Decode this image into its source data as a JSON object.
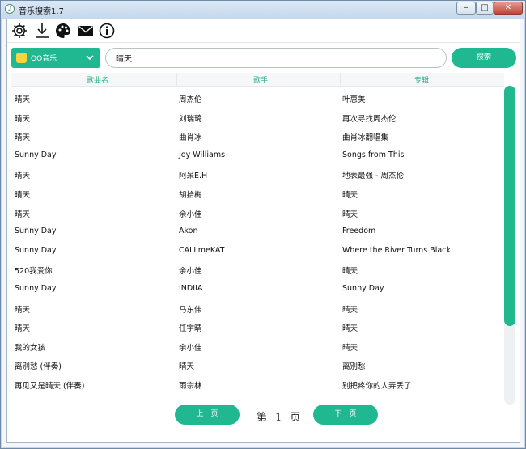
{
  "window": {
    "title": "音乐搜索1.7",
    "controls": {
      "minimize": "–",
      "maximize": "□",
      "close": "✕"
    }
  },
  "toolbar": {
    "icons": [
      "gear-icon",
      "download-icon",
      "palette-icon",
      "mail-icon",
      "info-icon"
    ]
  },
  "search": {
    "source": "QQ音乐",
    "query": "晴天",
    "button": "搜索"
  },
  "table": {
    "columns": [
      "歌曲名",
      "歌手",
      "专辑"
    ],
    "rows": [
      [
        "晴天",
        "周杰伦",
        "叶惠美"
      ],
      [
        "晴天",
        "刘瑞琦",
        "再次寻找周杰伦"
      ],
      [
        "晴天",
        "曲肖冰",
        "曲肖冰翻唱集"
      ],
      [
        "Sunny Day",
        "Joy Williams",
        "Songs from This"
      ],
      [
        "晴天",
        "阿呆E.H",
        "地表最强 - 周杰伦"
      ],
      [
        "晴天",
        "胡拾梅",
        "晴天"
      ],
      [
        "晴天",
        "余小佳",
        "晴天"
      ],
      [
        "Sunny Day",
        "Akon",
        "Freedom"
      ],
      [
        "Sunny Day",
        "CALLmeKAT",
        "Where the River Turns Black"
      ],
      [
        "520我爱你",
        "余小佳",
        "晴天"
      ],
      [
        "Sunny Day",
        "INDIIA",
        "Sunny Day"
      ],
      [
        "晴天",
        "马东伟",
        "晴天"
      ],
      [
        "晴天",
        "任宇晴",
        "晴天"
      ],
      [
        "我的女孩",
        "余小佳",
        "晴天"
      ],
      [
        "离别愁 (伴奏)",
        "晴天",
        "离别愁"
      ],
      [
        "再见又是晴天 (伴奏)",
        "雨宗林",
        "别把疼你的人弄丢了"
      ]
    ]
  },
  "pager": {
    "prev": "上一页",
    "page_prefix": "第",
    "page": "1",
    "page_suffix": "页",
    "next": "下一页"
  },
  "scroll": {
    "position": 0
  },
  "colors": {
    "accent": "#20b890"
  }
}
